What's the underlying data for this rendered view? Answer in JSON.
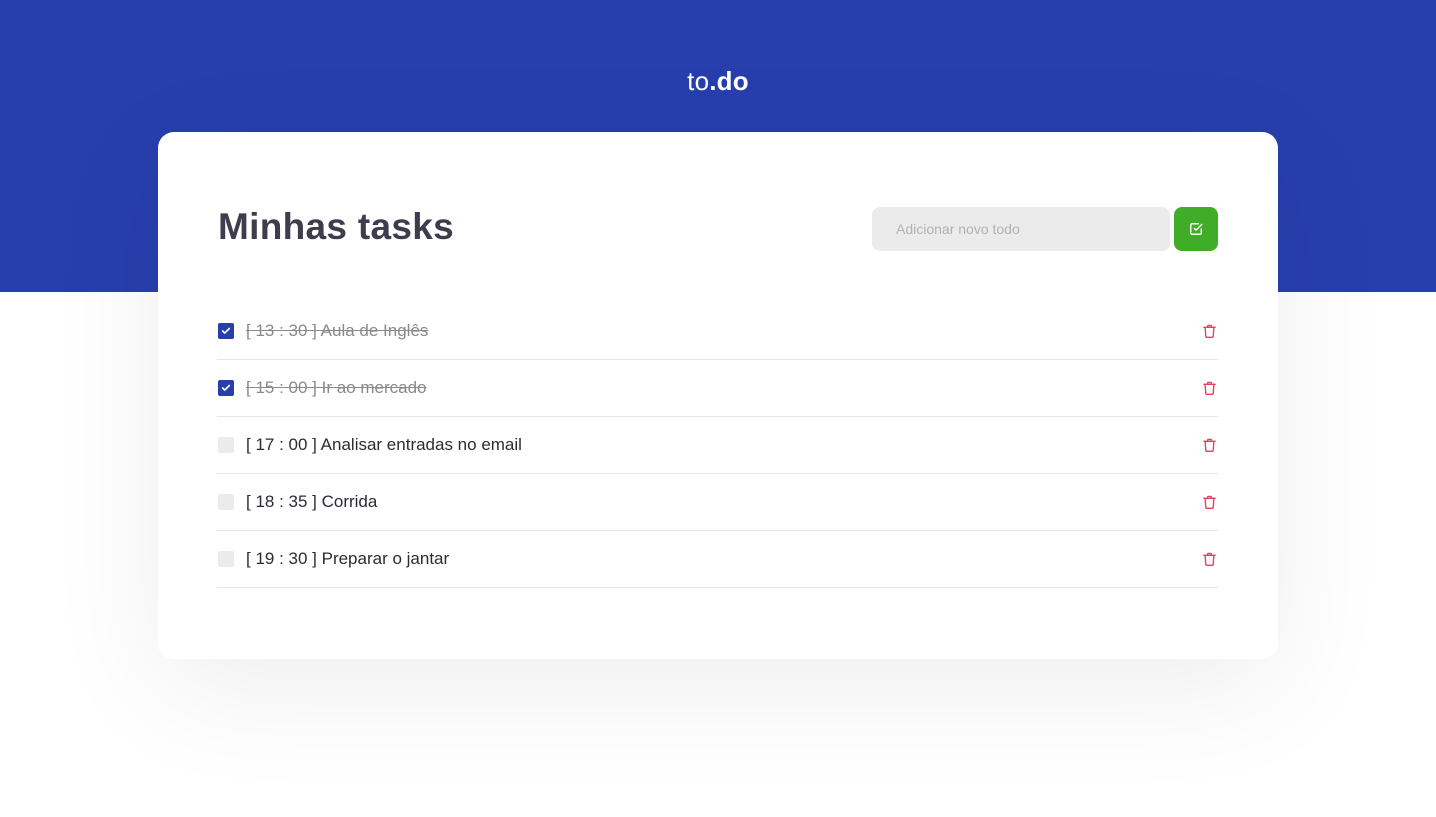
{
  "header": {
    "logo_light": "to",
    "logo_bold": ".do",
    "background_color": "#273fad"
  },
  "card": {
    "title": "Minhas tasks"
  },
  "new_todo": {
    "placeholder": "Adicionar novo todo",
    "value": "",
    "button_icon": "check-square-icon",
    "button_color": "#3fad27"
  },
  "tasks": [
    {
      "text": "[ 13 : 30 ] Aula de Inglês",
      "done": true
    },
    {
      "text": "[ 15 : 00 ] Ir ao mercado",
      "done": true
    },
    {
      "text": "[ 17 : 00 ] Analisar entradas no email",
      "done": false
    },
    {
      "text": "[ 18 : 35 ] Corrida",
      "done": false
    },
    {
      "text": "[ 19 : 30 ] Preparar o jantar",
      "done": false
    }
  ],
  "icons": {
    "checkbox_check": "check-icon",
    "delete": "trash-icon"
  },
  "colors": {
    "accent": "#273fad",
    "success": "#3fad27",
    "danger": "#e83f5b",
    "title": "#3d3d4d"
  }
}
